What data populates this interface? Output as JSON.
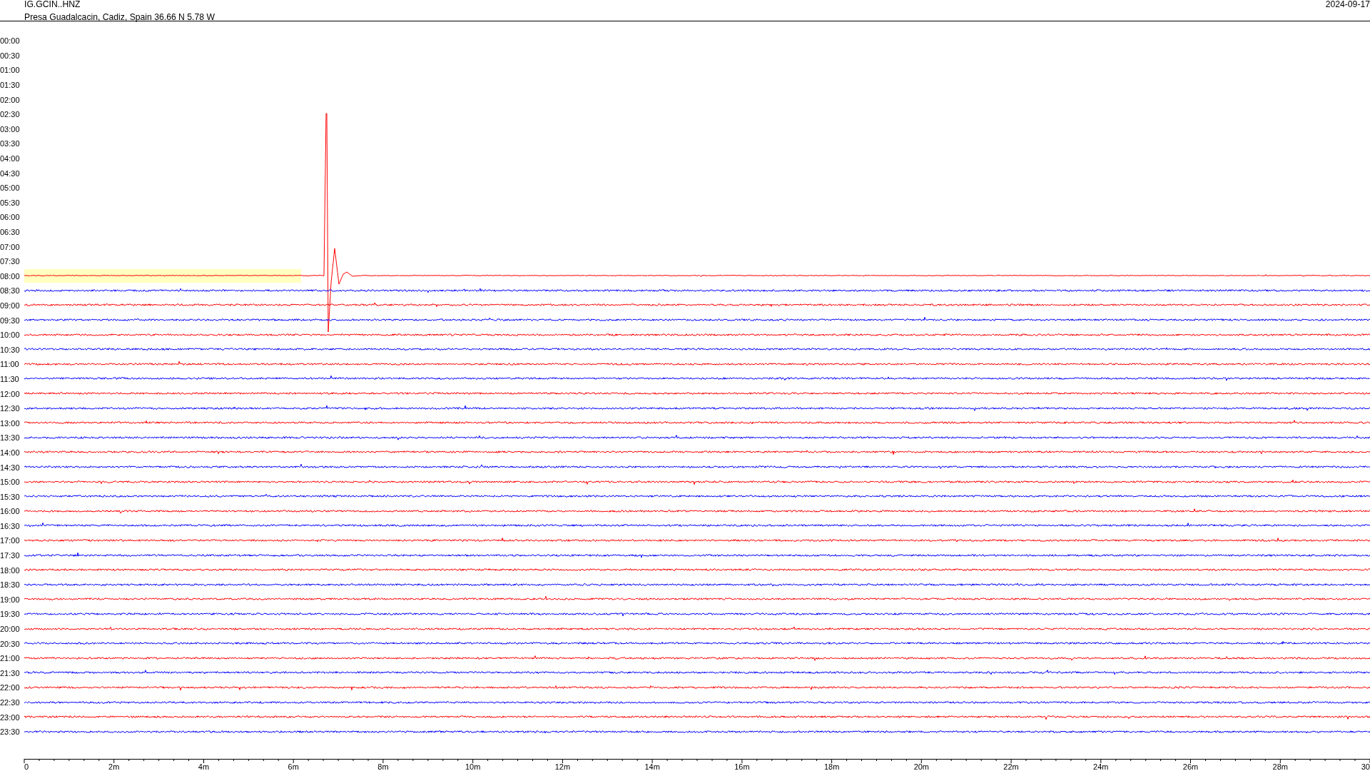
{
  "header": {
    "station": "IG.GCIN..HNZ",
    "location": "Presa Guadalcacin, Cadiz, Spain  36.66 N 5.78 W",
    "date": "2024-09-17"
  },
  "rows": [
    {
      "time": "00:00",
      "kind": "none",
      "highlighted": false
    },
    {
      "time": "00:30",
      "kind": "none",
      "highlighted": false
    },
    {
      "time": "01:00",
      "kind": "none",
      "highlighted": false
    },
    {
      "time": "01:30",
      "kind": "none",
      "highlighted": false
    },
    {
      "time": "02:00",
      "kind": "none",
      "highlighted": false
    },
    {
      "time": "02:30",
      "kind": "none",
      "highlighted": false
    },
    {
      "time": "03:00",
      "kind": "none",
      "highlighted": false
    },
    {
      "time": "03:30",
      "kind": "none",
      "highlighted": false
    },
    {
      "time": "04:00",
      "kind": "none",
      "highlighted": false
    },
    {
      "time": "04:30",
      "kind": "none",
      "highlighted": false
    },
    {
      "time": "05:00",
      "kind": "none",
      "highlighted": false
    },
    {
      "time": "05:30",
      "kind": "none",
      "highlighted": false
    },
    {
      "time": "06:00",
      "kind": "none",
      "highlighted": false
    },
    {
      "time": "06:30",
      "kind": "none",
      "highlighted": false
    },
    {
      "time": "07:00",
      "kind": "none",
      "highlighted": false
    },
    {
      "time": "07:30",
      "kind": "none",
      "highlighted": false
    },
    {
      "time": "08:00",
      "kind": "event",
      "highlighted": true,
      "color": "#ff0000"
    },
    {
      "time": "08:30",
      "kind": "trace",
      "highlighted": false,
      "color": "#0000ff"
    },
    {
      "time": "09:00",
      "kind": "trace",
      "highlighted": false,
      "color": "#ff0000"
    },
    {
      "time": "09:30",
      "kind": "trace",
      "highlighted": false,
      "color": "#0000ff"
    },
    {
      "time": "10:00",
      "kind": "trace",
      "highlighted": false,
      "color": "#ff0000"
    },
    {
      "time": "10:30",
      "kind": "trace",
      "highlighted": false,
      "color": "#0000ff"
    },
    {
      "time": "11:00",
      "kind": "trace",
      "highlighted": false,
      "color": "#ff0000"
    },
    {
      "time": "11:30",
      "kind": "trace",
      "highlighted": false,
      "color": "#0000ff"
    },
    {
      "time": "12:00",
      "kind": "trace",
      "highlighted": false,
      "color": "#ff0000"
    },
    {
      "time": "12:30",
      "kind": "trace",
      "highlighted": false,
      "color": "#0000ff"
    },
    {
      "time": "13:00",
      "kind": "trace",
      "highlighted": false,
      "color": "#ff0000"
    },
    {
      "time": "13:30",
      "kind": "trace",
      "highlighted": false,
      "color": "#0000ff"
    },
    {
      "time": "14:00",
      "kind": "trace",
      "highlighted": false,
      "color": "#ff0000"
    },
    {
      "time": "14:30",
      "kind": "trace",
      "highlighted": false,
      "color": "#0000ff"
    },
    {
      "time": "15:00",
      "kind": "trace",
      "highlighted": false,
      "color": "#ff0000"
    },
    {
      "time": "15:30",
      "kind": "trace",
      "highlighted": false,
      "color": "#0000ff"
    },
    {
      "time": "16:00",
      "kind": "trace",
      "highlighted": false,
      "color": "#ff0000"
    },
    {
      "time": "16:30",
      "kind": "trace",
      "highlighted": false,
      "color": "#0000ff"
    },
    {
      "time": "17:00",
      "kind": "trace",
      "highlighted": false,
      "color": "#ff0000"
    },
    {
      "time": "17:30",
      "kind": "trace",
      "highlighted": false,
      "color": "#0000ff"
    },
    {
      "time": "18:00",
      "kind": "trace",
      "highlighted": false,
      "color": "#ff0000"
    },
    {
      "time": "18:30",
      "kind": "trace",
      "highlighted": false,
      "color": "#0000ff"
    },
    {
      "time": "19:00",
      "kind": "trace",
      "highlighted": false,
      "color": "#ff0000"
    },
    {
      "time": "19:30",
      "kind": "trace",
      "highlighted": false,
      "color": "#0000ff"
    },
    {
      "time": "20:00",
      "kind": "trace",
      "highlighted": false,
      "color": "#ff0000"
    },
    {
      "time": "20:30",
      "kind": "trace",
      "highlighted": false,
      "color": "#0000ff"
    },
    {
      "time": "21:00",
      "kind": "trace",
      "highlighted": false,
      "color": "#ff0000"
    },
    {
      "time": "21:30",
      "kind": "trace",
      "highlighted": false,
      "color": "#0000ff"
    },
    {
      "time": "22:00",
      "kind": "trace",
      "highlighted": false,
      "color": "#ff0000"
    },
    {
      "time": "22:30",
      "kind": "trace",
      "highlighted": false,
      "color": "#0000ff"
    },
    {
      "time": "23:00",
      "kind": "trace",
      "highlighted": false,
      "color": "#ff0000"
    },
    {
      "time": "23:30",
      "kind": "trace",
      "highlighted": false,
      "color": "#0000ff"
    }
  ],
  "x_axis": {
    "labels": [
      "0",
      "2m",
      "4m",
      "6m",
      "8m",
      "10m",
      "12m",
      "14m",
      "16m",
      "18m",
      "20m",
      "22m",
      "24m",
      "26m",
      "28m",
      "30"
    ]
  }
}
